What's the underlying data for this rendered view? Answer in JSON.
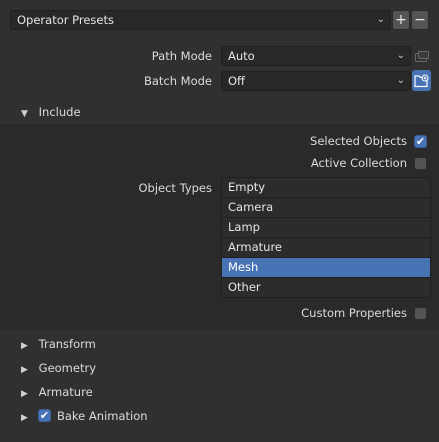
{
  "presets": {
    "label": "Operator Presets",
    "add": "+",
    "remove": "−"
  },
  "path_mode": {
    "label": "Path Mode",
    "value": "Auto"
  },
  "batch_mode": {
    "label": "Batch Mode",
    "value": "Off"
  },
  "include": {
    "title": "Include",
    "selected_objects": {
      "label": "Selected Objects",
      "checked": true
    },
    "active_collection": {
      "label": "Active Collection",
      "checked": false
    },
    "object_types": {
      "label": "Object Types",
      "items": [
        "Empty",
        "Camera",
        "Lamp",
        "Armature",
        "Mesh",
        "Other"
      ],
      "selected": "Mesh"
    },
    "custom_properties": {
      "label": "Custom Properties",
      "checked": false
    }
  },
  "panels": {
    "transform": "Transform",
    "geometry": "Geometry",
    "armature": "Armature",
    "bake_animation": {
      "label": "Bake Animation",
      "checked": true
    }
  },
  "colors": {
    "accent": "#4772b3",
    "background": "#303030",
    "panel": "#2a2a2a"
  }
}
